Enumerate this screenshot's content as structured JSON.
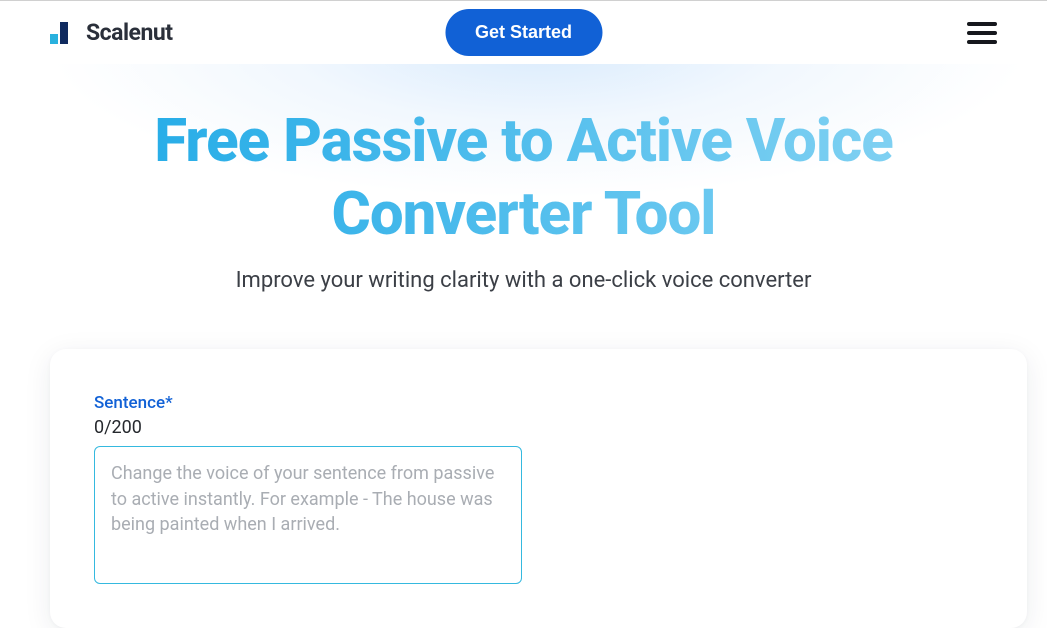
{
  "brand": {
    "name": "Scalenut"
  },
  "header": {
    "cta_label": "Get Started"
  },
  "hero": {
    "title": "Free Passive to Active Voice Converter Tool",
    "subtitle": "Improve your writing clarity with a one-click voice converter"
  },
  "form": {
    "field_label": "Sentence*",
    "counter": "0/200",
    "placeholder": "Change the voice of your sentence from passive to active instantly. For example - The house was being painted when I arrived.",
    "value": ""
  }
}
